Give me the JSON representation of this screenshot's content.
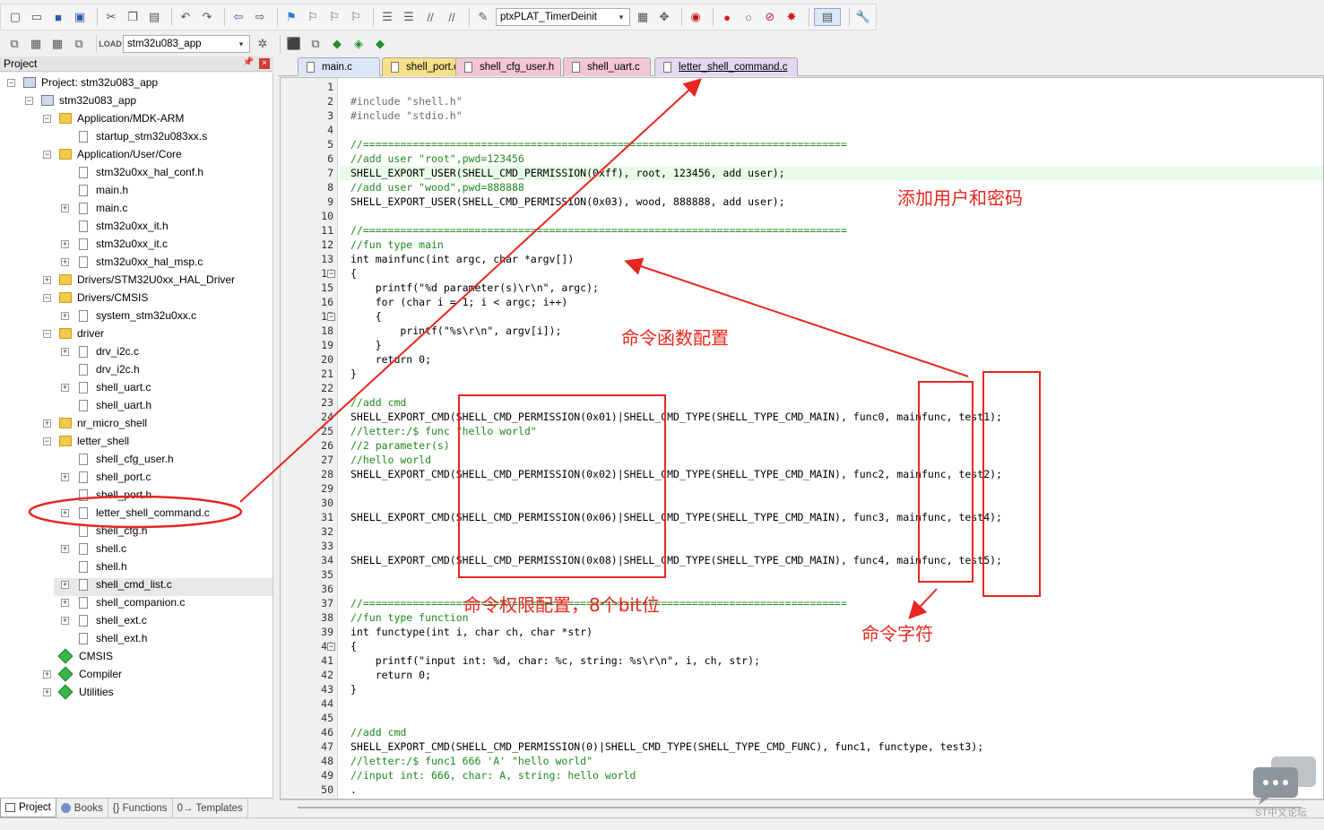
{
  "toolbar": {
    "target_combo": "ptxPLAT_TimerDeinit",
    "project_combo": "stm32u083_app"
  },
  "project_panel": {
    "title": "Project",
    "tree": [
      {
        "label": "Project: stm32u083_app"
      },
      {
        "label": "stm32u083_app"
      },
      {
        "label": "Application/MDK-ARM"
      },
      {
        "label": "startup_stm32u083xx.s"
      },
      {
        "label": "Application/User/Core"
      },
      {
        "label": "stm32u0xx_hal_conf.h"
      },
      {
        "label": "main.h"
      },
      {
        "label": "main.c"
      },
      {
        "label": "stm32u0xx_it.h"
      },
      {
        "label": "stm32u0xx_it.c"
      },
      {
        "label": "stm32u0xx_hal_msp.c"
      },
      {
        "label": "Drivers/STM32U0xx_HAL_Driver"
      },
      {
        "label": "Drivers/CMSIS"
      },
      {
        "label": "system_stm32u0xx.c"
      },
      {
        "label": "driver"
      },
      {
        "label": "drv_i2c.c"
      },
      {
        "label": "drv_i2c.h"
      },
      {
        "label": "shell_uart.c"
      },
      {
        "label": "shell_uart.h"
      },
      {
        "label": "nr_micro_shell"
      },
      {
        "label": "letter_shell"
      },
      {
        "label": "shell_cfg_user.h"
      },
      {
        "label": "shell_port.c"
      },
      {
        "label": "shell_port.h"
      },
      {
        "label": "letter_shell_command.c"
      },
      {
        "label": "shell_cfg.h"
      },
      {
        "label": "shell.c"
      },
      {
        "label": "shell.h"
      },
      {
        "label": "shell_cmd_list.c"
      },
      {
        "label": "shell_companion.c"
      },
      {
        "label": "shell_ext.c"
      },
      {
        "label": "shell_ext.h"
      },
      {
        "label": "CMSIS"
      },
      {
        "label": "Compiler"
      },
      {
        "label": "Utilities"
      }
    ],
    "bottom_tabs": [
      "Project",
      "Books",
      "{} Functions",
      "0→ Templates"
    ]
  },
  "editor_tabs": [
    {
      "label": "main.c"
    },
    {
      "label": "shell_port.c"
    },
    {
      "label": "shell_cfg_user.h"
    },
    {
      "label": "shell_uart.c"
    },
    {
      "label": "letter_shell_command.c"
    }
  ],
  "code_lines": [
    "",
    "#include \"shell.h\"",
    "#include \"stdio.h\"",
    "",
    "//==============================================================================",
    "//add user \"root\",pwd=123456",
    "SHELL_EXPORT_USER(SHELL_CMD_PERMISSION(0xff), root, 123456, add user);",
    "//add user \"wood\",pwd=888888",
    "SHELL_EXPORT_USER(SHELL_CMD_PERMISSION(0x03), wood, 888888, add user);",
    "",
    "//==============================================================================",
    "//fun type main",
    "int mainfunc(int argc, char *argv[])",
    "{",
    "    printf(\"%d parameter(s)\\r\\n\", argc);",
    "    for (char i = 1; i < argc; i++)",
    "    {",
    "        printf(\"%s\\r\\n\", argv[i]);",
    "    }",
    "    return 0;",
    "}",
    "",
    "//add cmd",
    "SHELL_EXPORT_CMD(SHELL_CMD_PERMISSION(0x01)|SHELL_CMD_TYPE(SHELL_TYPE_CMD_MAIN), func0, mainfunc, test1);",
    "//letter:/$ func \"hello world\"",
    "//2 parameter(s)",
    "//hello world",
    "SHELL_EXPORT_CMD(SHELL_CMD_PERMISSION(0x02)|SHELL_CMD_TYPE(SHELL_TYPE_CMD_MAIN), func2, mainfunc, test2);",
    "",
    "",
    "SHELL_EXPORT_CMD(SHELL_CMD_PERMISSION(0x06)|SHELL_CMD_TYPE(SHELL_TYPE_CMD_MAIN), func3, mainfunc, test4);",
    "",
    "",
    "SHELL_EXPORT_CMD(SHELL_CMD_PERMISSION(0x08)|SHELL_CMD_TYPE(SHELL_TYPE_CMD_MAIN), func4, mainfunc, test5);",
    "",
    "",
    "//==============================================================================",
    "//fun type function",
    "int functype(int i, char ch, char *str)",
    "{",
    "    printf(\"input int: %d, char: %c, string: %s\\r\\n\", i, ch, str);",
    "    return 0;",
    "}",
    "",
    "",
    "//add cmd",
    "SHELL_EXPORT_CMD(SHELL_CMD_PERMISSION(0)|SHELL_CMD_TYPE(SHELL_TYPE_CMD_FUNC), func1, functype, test3);",
    "//letter:/$ func1 666 'A' \"hello world\"",
    "//input int: 666, char: A, string: hello world",
    "."
  ],
  "annotations": {
    "add_user": "添加用户和密码",
    "cmd_func": "命令函数配置",
    "perm": "命令权限配置，8个bit位",
    "cmd_char": "命令字符"
  },
  "watermark": "ST中文论坛"
}
